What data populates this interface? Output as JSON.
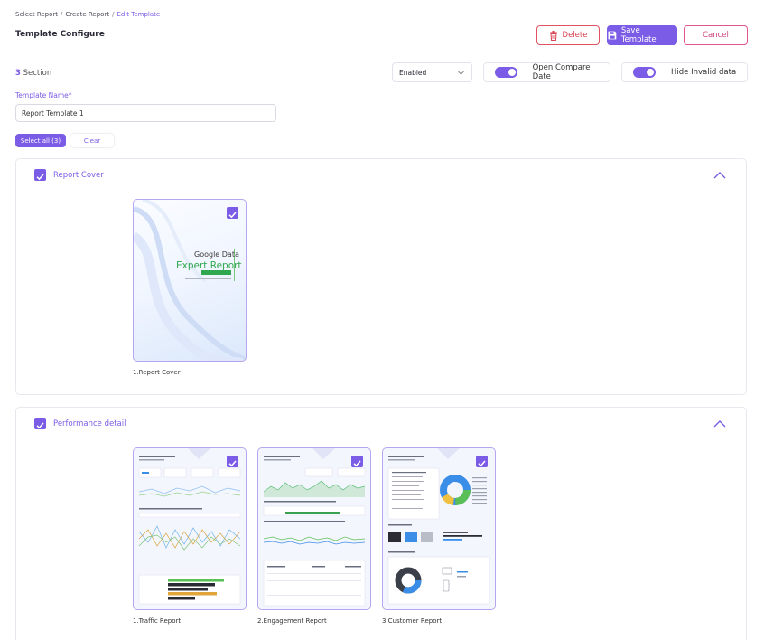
{
  "breadcrumb": {
    "items": [
      "Select Report",
      "Create Report"
    ],
    "current": "Edit Template"
  },
  "page_title": "Template Configure",
  "actions": {
    "delete_label": "Delete",
    "save_label": "Save Template",
    "cancel_label": "Cancel"
  },
  "sections": {
    "count": "3",
    "label": "Section"
  },
  "status_select": {
    "value": "Enabled"
  },
  "toggles": {
    "compare": {
      "label": "Open Compare Date",
      "on": true
    },
    "hide_invalid": {
      "label": "Hide Invalid data",
      "on": true
    }
  },
  "template_name": {
    "label": "Template Name*",
    "value": "Report Template 1"
  },
  "selection": {
    "select_all_label": "Select all (3)",
    "clear_label": "Clear"
  },
  "panels": [
    {
      "title": "Report Cover",
      "checked": true,
      "items": [
        {
          "label": "1.Report Cover",
          "checked": true,
          "cover_title": "Google Data",
          "cover_subtitle": "Expert Report"
        }
      ]
    },
    {
      "title": "Performance detail",
      "checked": true,
      "items": [
        {
          "label": "1.Traffic Report",
          "checked": true
        },
        {
          "label": "2.Engagement Report",
          "checked": true
        },
        {
          "label": "3.Customer Report",
          "checked": true
        }
      ]
    }
  ],
  "colors": {
    "accent": "#7b5ce6",
    "danger": "#d8404f",
    "cancel": "#d0457f",
    "cover_green": "#2fa84f"
  }
}
